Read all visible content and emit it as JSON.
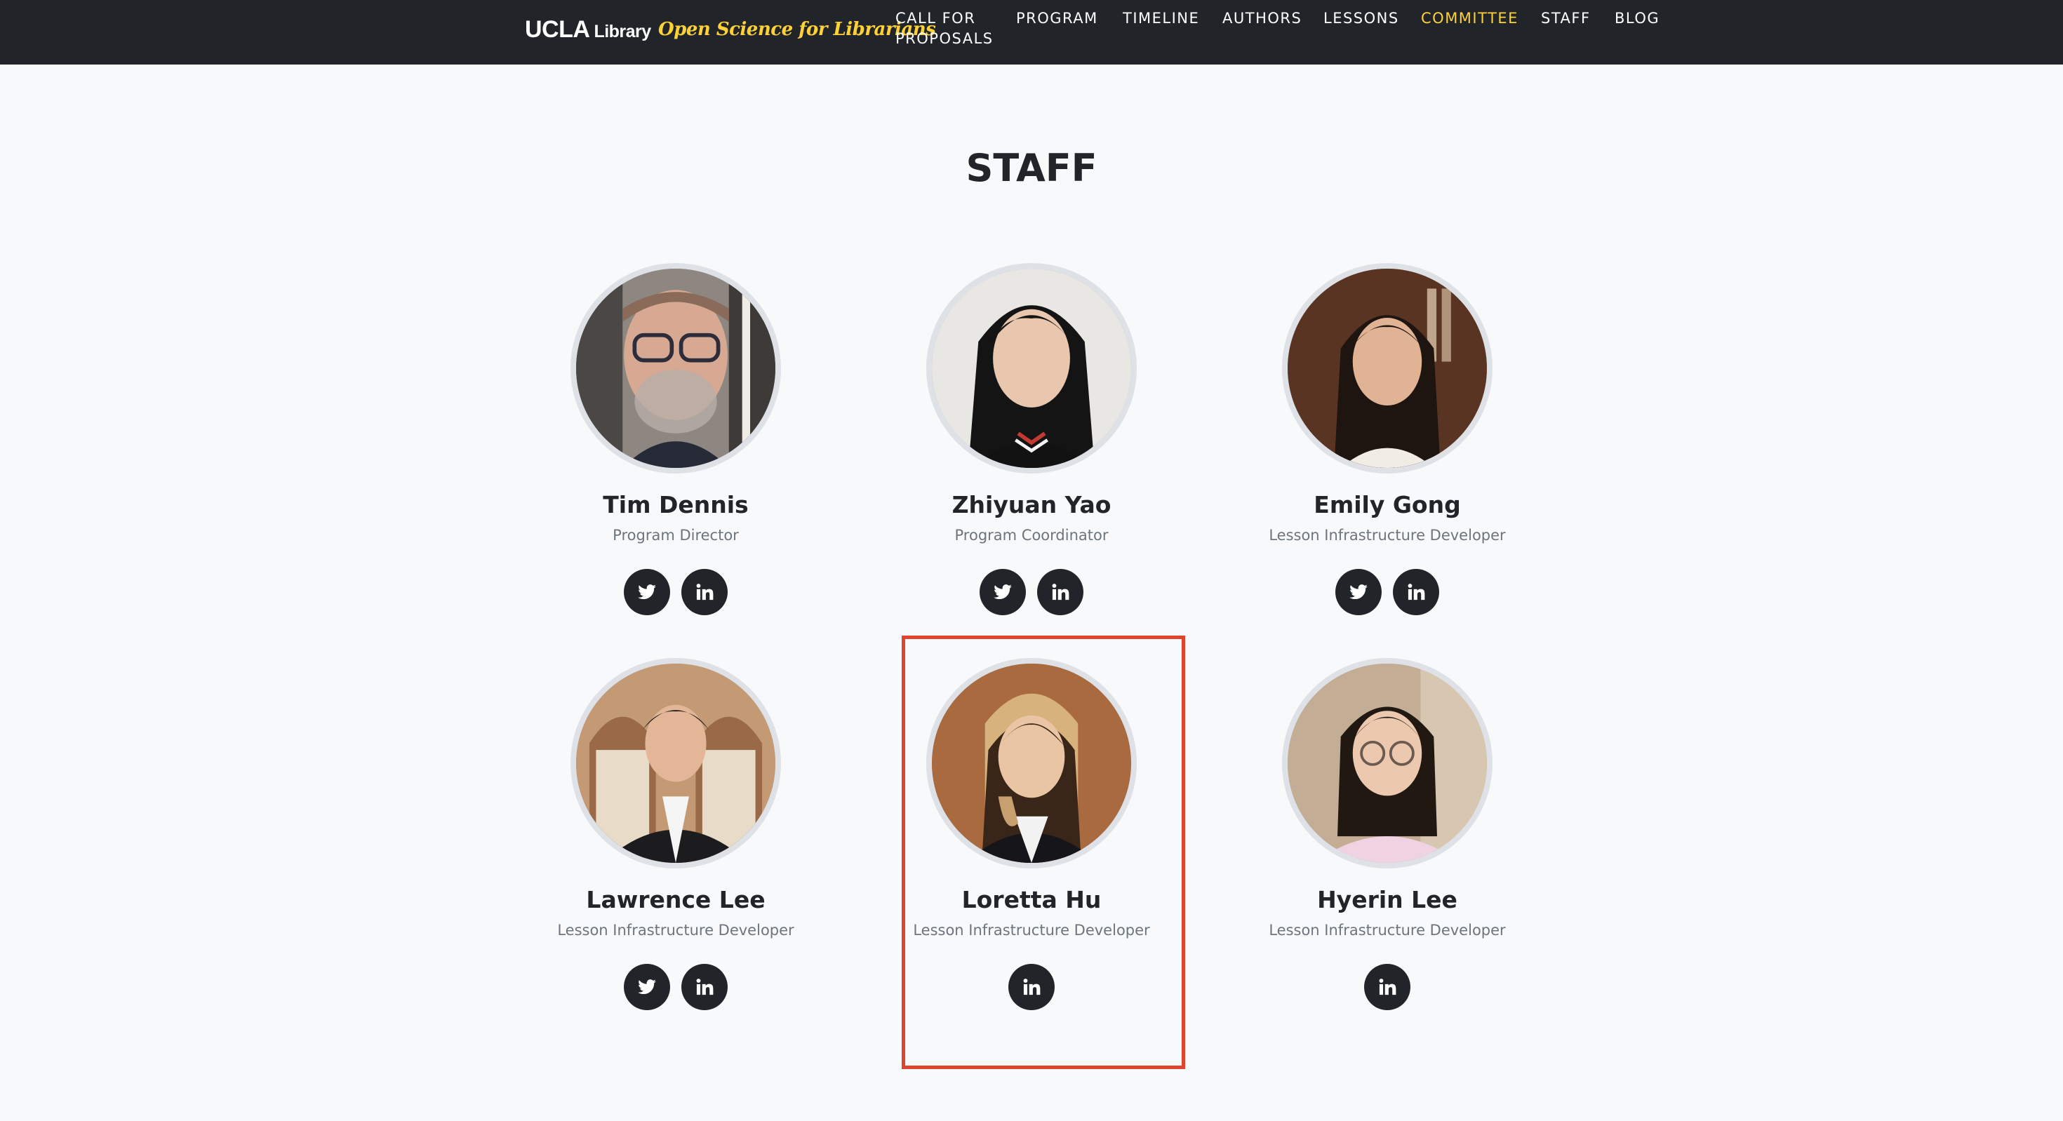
{
  "brand": {
    "ucla": "UCLA",
    "library": "Library",
    "tagline": "Open Science for Librarians"
  },
  "nav": {
    "items": [
      {
        "label": "CALL FOR PROPOSALS"
      },
      {
        "label": "PROGRAM"
      },
      {
        "label": "TIMELINE"
      },
      {
        "label": "AUTHORS"
      },
      {
        "label": "LESSONS"
      },
      {
        "label": "COMMITTEE"
      },
      {
        "label": "STAFF"
      },
      {
        "label": "BLOG"
      }
    ]
  },
  "page": {
    "heading": "STAFF"
  },
  "staff": [
    {
      "name": "Tim Dennis",
      "role": "Program Director",
      "socials": [
        "twitter-icon",
        "linkedin-icon"
      ]
    },
    {
      "name": "Zhiyuan Yao",
      "role": "Program Coordinator",
      "socials": [
        "twitter-icon",
        "linkedin-icon"
      ]
    },
    {
      "name": "Emily Gong",
      "role": "Lesson Infrastructure Developer",
      "socials": [
        "twitter-icon",
        "linkedin-icon"
      ]
    },
    {
      "name": "Lawrence Lee",
      "role": "Lesson Infrastructure Developer",
      "socials": [
        "twitter-icon",
        "linkedin-icon"
      ]
    },
    {
      "name": "Loretta Hu",
      "role": "Lesson Infrastructure Developer",
      "socials": [
        "linkedin-icon"
      ]
    },
    {
      "name": "Hyerin Lee",
      "role": "Lesson Infrastructure Developer",
      "socials": [
        "linkedin-icon"
      ]
    }
  ],
  "colors": {
    "navbar_bg": "#212529",
    "accent": "#fed136",
    "page_bg": "#f8f9fa",
    "social_btn_bg": "#212529",
    "highlight": "#e0442c"
  }
}
